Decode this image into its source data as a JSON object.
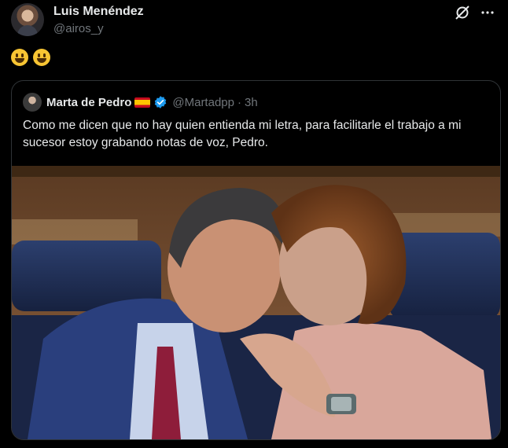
{
  "retweeter": {
    "name": "Luis Menéndez",
    "handle": "@airos_y"
  },
  "tweet": {
    "text": "😃😃"
  },
  "quoted": {
    "name": "Marta de Pedro",
    "handle": "@Martadpp",
    "separator": "·",
    "time": "3h",
    "text": "Como me dicen que no hay quien entienda mi letra, para facilitarle el trabajo a mi sucesor estoy grabando notas de voz, Pedro."
  },
  "icons": [
    "grok-icon",
    "more-icon",
    "verified-icon",
    "spain-flag-icon"
  ],
  "colors": {
    "background": "#000000",
    "text": "#e7e9ea",
    "secondary": "#71767b",
    "verified": "#1d9bf0",
    "border": "#2f3336"
  }
}
